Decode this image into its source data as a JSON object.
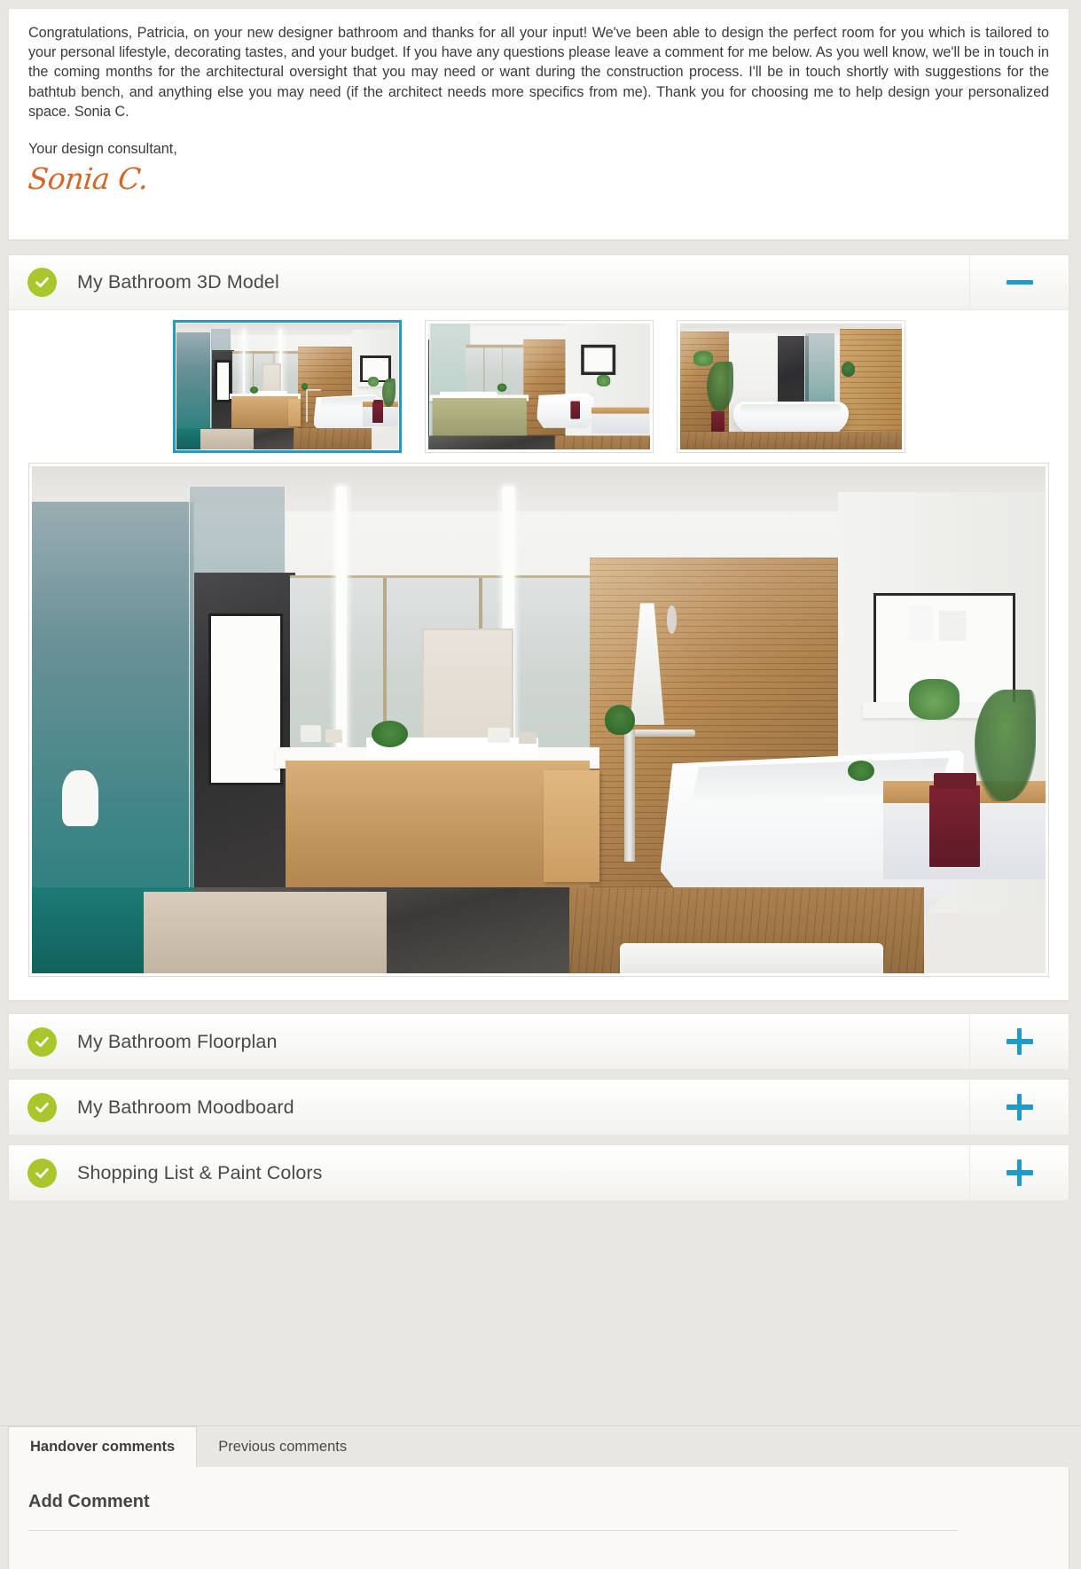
{
  "message": {
    "body": "Congratulations, Patricia, on your new designer bathroom and thanks for all your input! We've been able to design the perfect room for you which is tailored to your personal lifestyle, decorating tastes, and your budget. If you have any questions please leave a comment for me below. As you well know, we'll be in touch in the coming months for the architectural oversight that you may need or want during the construction process. I'll be in touch shortly with suggestions for the bathtub bench, and anything else you may need (if the architect needs more specifics from me). Thank you for choosing me to help design your personalized space. Sonia C.",
    "signoff": "Your design consultant,",
    "signature": "Sonia C."
  },
  "accordion": {
    "sections": [
      {
        "id": "model-3d",
        "title": "My Bathroom 3D Model",
        "status_icon": "check-circle-icon",
        "expanded": true,
        "toggle_icon": "minus-icon",
        "thumbnails": [
          {
            "label": "Bathroom view 1",
            "selected": true
          },
          {
            "label": "Bathroom view 2",
            "selected": false
          },
          {
            "label": "Bathroom view 3",
            "selected": false
          }
        ],
        "hero_label": "Bathroom 3D render - view 1"
      },
      {
        "id": "floorplan",
        "title": "My Bathroom Floorplan",
        "status_icon": "check-circle-icon",
        "expanded": false,
        "toggle_icon": "plus-icon"
      },
      {
        "id": "moodboard",
        "title": "My Bathroom Moodboard",
        "status_icon": "check-circle-icon",
        "expanded": false,
        "toggle_icon": "plus-icon"
      },
      {
        "id": "shopping-list",
        "title": "Shopping List & Paint Colors",
        "status_icon": "check-circle-icon",
        "expanded": false,
        "toggle_icon": "plus-icon"
      }
    ]
  },
  "comments": {
    "tabs": [
      {
        "label": "Handover comments",
        "active": true
      },
      {
        "label": "Previous comments",
        "active": false
      }
    ],
    "add_comment_title": "Add Comment"
  },
  "colors": {
    "accent_teal": "#1f9bc4",
    "status_green": "#a8c72c",
    "signature_orange": "#d4662a",
    "page_background": "#e9e7e2",
    "panel_background": "#ffffff"
  }
}
